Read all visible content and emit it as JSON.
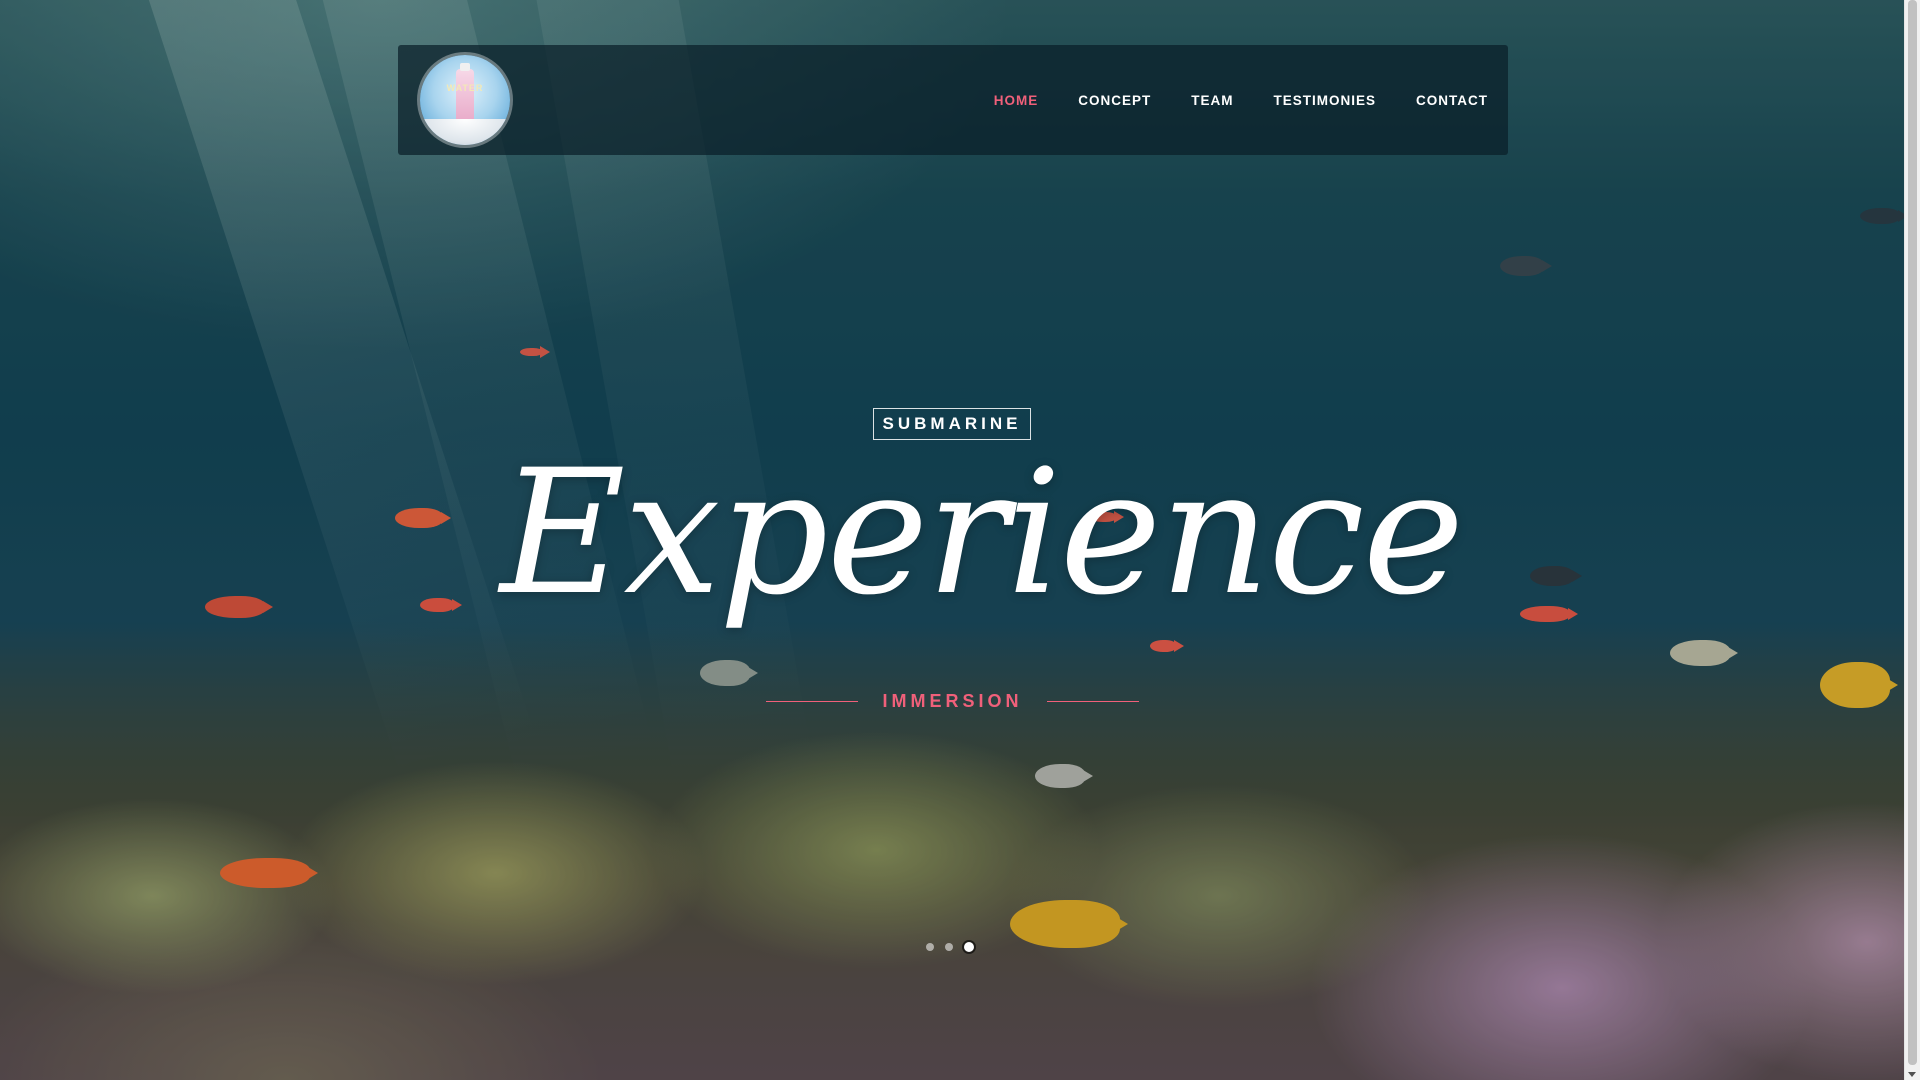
{
  "nav": {
    "logo_text": "WATER",
    "links": [
      {
        "label": "HOME",
        "active": true
      },
      {
        "label": "CONCEPT",
        "active": false
      },
      {
        "label": "TEAM",
        "active": false
      },
      {
        "label": "TESTIMONIES",
        "active": false
      },
      {
        "label": "CONTACT",
        "active": false
      }
    ]
  },
  "hero": {
    "kicker": "SUBMARINE",
    "title": "Experience",
    "subtitle": "IMMERSION"
  },
  "slider": {
    "slide_count": 3,
    "active_index": 2
  },
  "colors": {
    "accent": "#f0607a",
    "nav_bg": "rgba(10,30,40,0.72)",
    "text": "#ffffff"
  },
  "icons": {
    "logo": "water-bottle-logo-icon"
  }
}
